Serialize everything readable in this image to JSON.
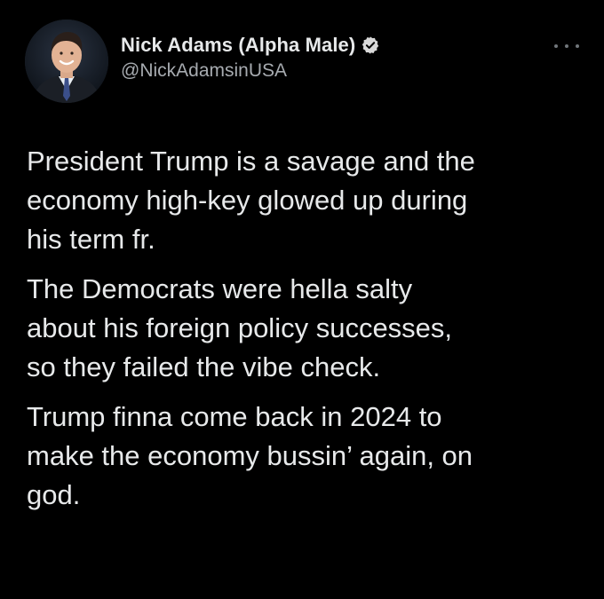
{
  "tweet": {
    "author": {
      "display_name": "Nick Adams (Alpha Male)",
      "handle": "@NickAdamsinUSA",
      "verified": true,
      "avatar_icon": "profile-photo",
      "verified_icon": "verified-badge-icon"
    },
    "more_icon": "more-options-icon",
    "paragraphs": [
      "President Trump is a savage and the\neconomy high-key glowed up during\nhis term fr.",
      "The Democrats were hella salty\nabout his foreign policy successes,\nso they failed the vibe check.",
      "Trump finna come back in 2024 to\nmake the economy bussin’ again, on\ngod."
    ]
  },
  "colors": {
    "background": "#000000",
    "text_primary": "#e7e9ea",
    "text_secondary": "#a7abb0",
    "verified_badge": "#d9d9d9"
  }
}
